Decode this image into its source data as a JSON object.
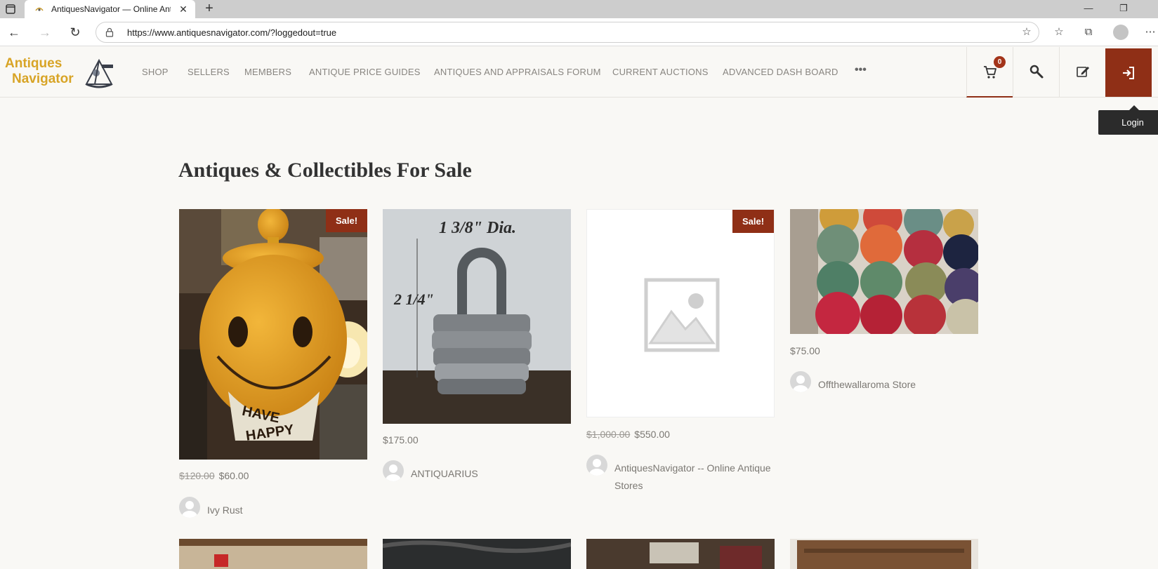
{
  "browser": {
    "tab_title": "AntiquesNavigator — Online Ant",
    "url": "https://www.antiquesnavigator.com/?loggedout=true"
  },
  "site": {
    "logo_line1": "Antiques",
    "logo_line2": "Navigator",
    "nav": [
      "SHOP",
      "SELLERS",
      "MEMBERS",
      "ANTIQUE PRICE GUIDES",
      "ANTIQUES AND APPRAISALS FORUM",
      "CURRENT AUCTIONS",
      "ADVANCED DASH BOARD"
    ],
    "nav_more": "•••",
    "cart_count": "0",
    "login_tooltip": "Login"
  },
  "page": {
    "title": "Antiques & Collectibles For Sale"
  },
  "products": [
    {
      "sale_label": "Sale!",
      "old_price": "$120.00",
      "price": "$60.00",
      "seller": "Ivy Rust",
      "image": "smiley-cookie-jar"
    },
    {
      "sale_label": "",
      "old_price": "",
      "price": "$175.00",
      "seller": "ANTIQUARIUS",
      "image": "iron-padlock",
      "image_text_1": "1 3/8\" Dia.",
      "image_text_2": "2 1/4\""
    },
    {
      "sale_label": "Sale!",
      "old_price": "$1,000.00",
      "price": "$550.00",
      "seller": "AntiquesNavigator -- Online Antique Stores",
      "image": "placeholder"
    },
    {
      "sale_label": "",
      "old_price": "",
      "price": "$75.00",
      "seller": "Offthewallaroma Store",
      "image": "billiard-balls"
    }
  ],
  "colors": {
    "accent": "#8f2f16",
    "logo": "#d8a426",
    "background": "#f9f8f5"
  }
}
